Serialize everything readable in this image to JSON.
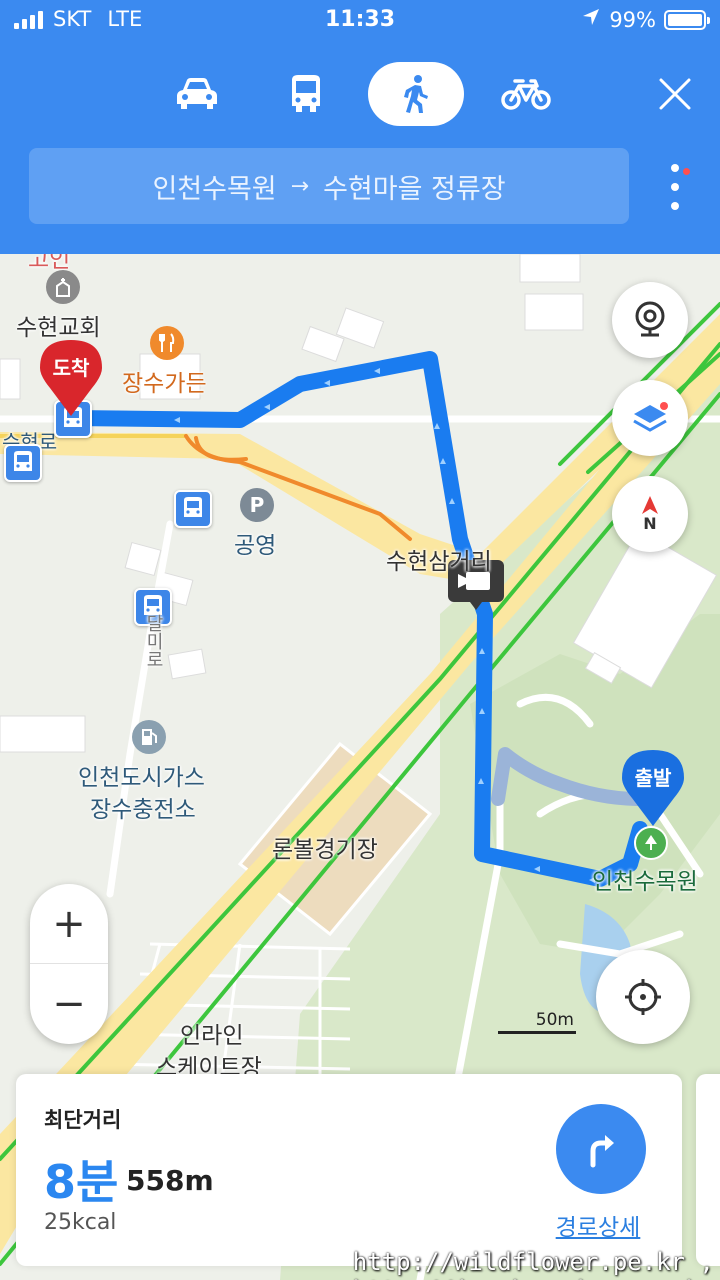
{
  "status_bar": {
    "carrier": "SKT",
    "network": "LTE",
    "time": "11:33",
    "battery": "99%"
  },
  "header": {
    "modes": [
      {
        "name": "car-icon",
        "active": false
      },
      {
        "name": "bus-icon",
        "active": false
      },
      {
        "name": "walk-icon",
        "active": true
      },
      {
        "name": "bike-icon",
        "active": false
      }
    ],
    "route": {
      "origin": "인천수목원",
      "arrow": "→",
      "destination": "수현마을 정류장"
    }
  },
  "map": {
    "labels": {
      "church": "수현교회",
      "restaurant": "장수가든",
      "road_suhyeon": "수현로",
      "parking": "공영",
      "intersection": "수현삼거리",
      "gas_station_line1": "인천도시가스",
      "gas_station_line2": "장수충전소",
      "baseball": "론볼경기장",
      "arboretum": "인천수목원",
      "skate_line1": "인라인",
      "skate_line2": "스케이트장",
      "dalli_road": "달미로",
      "top_fragment": "고인"
    },
    "pins": {
      "destination": "도착",
      "origin": "출발"
    },
    "parking_glyph": "P",
    "compass": "N",
    "scale": "50m",
    "zoom_in": "+",
    "zoom_out": "−",
    "colors": {
      "route": "#1a7cf0",
      "alt_route": "#9bb4d8",
      "traffic_green": "#3dc63d",
      "traffic_orange": "#f08a2c",
      "road": "#fbe7a1"
    }
  },
  "summary": {
    "title": "최단거리",
    "time": "8분",
    "distance": "558m",
    "calories": "25kcal",
    "detail_link": "경로상세"
  },
  "watermark": "http://wildflower.pe.kr , http://jungbomadang.pe.kr"
}
